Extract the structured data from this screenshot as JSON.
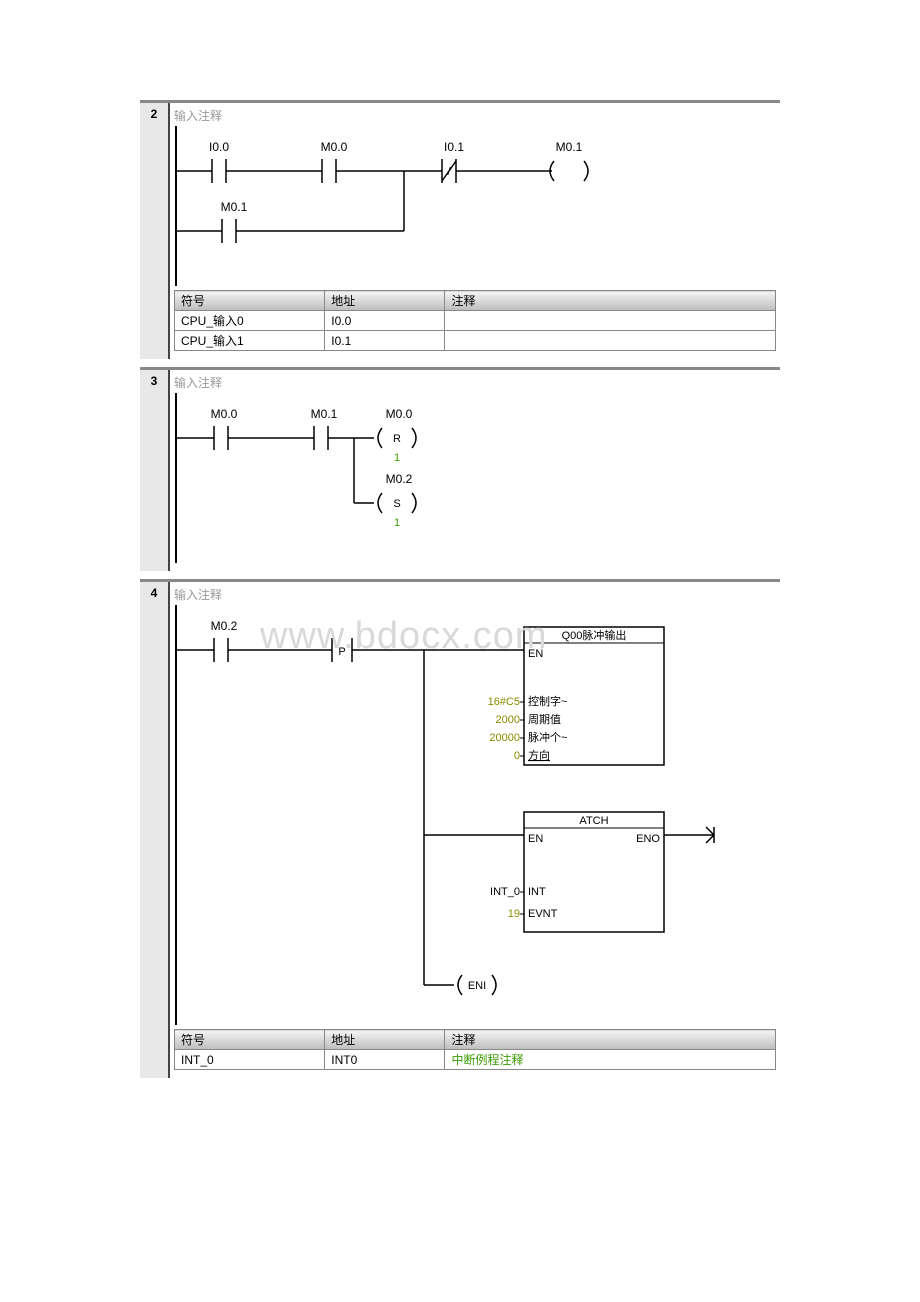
{
  "watermark": "www.bdocx.com",
  "networks": {
    "n2": {
      "num": "2",
      "comment": "输入注释",
      "contacts": {
        "i00": "I0.0",
        "m00": "M0.0",
        "i01": "I0.1",
        "m01_coil": "M0.1",
        "m01": "M0.1"
      },
      "table": {
        "headers": {
          "sym": "符号",
          "addr": "地址",
          "cmt": "注释"
        },
        "rows": [
          {
            "sym": "CPU_输入0",
            "addr": "I0.0",
            "cmt": ""
          },
          {
            "sym": "CPU_输入1",
            "addr": "I0.1",
            "cmt": ""
          }
        ]
      }
    },
    "n3": {
      "num": "3",
      "comment": "输入注释",
      "contacts": {
        "m00": "M0.0",
        "m01": "M0.1",
        "r_addr": "M0.0",
        "r_op": "R",
        "r_n": "1",
        "s_addr": "M0.2",
        "s_op": "S",
        "s_n": "1"
      }
    },
    "n4": {
      "num": "4",
      "comment": "输入注释",
      "contacts": {
        "m02": "M0.2",
        "p": "P"
      },
      "box1": {
        "title": "Q00脉冲输出",
        "en": "EN",
        "params": [
          {
            "val": "16#C5",
            "name": "控制字~"
          },
          {
            "val": "2000",
            "name": "周期值"
          },
          {
            "val": "20000",
            "name": "脉冲个~"
          },
          {
            "val": "0",
            "name": "方向"
          }
        ]
      },
      "box2": {
        "title": "ATCH",
        "en": "EN",
        "eno": "ENO",
        "params": [
          {
            "val": "INT_0",
            "name": "INT"
          },
          {
            "val": "19",
            "name": "EVNT"
          }
        ]
      },
      "eni": "ENI",
      "table": {
        "headers": {
          "sym": "符号",
          "addr": "地址",
          "cmt": "注释"
        },
        "rows": [
          {
            "sym": "INT_0",
            "addr": "INT0",
            "cmt": "中断例程注释"
          }
        ]
      }
    }
  }
}
